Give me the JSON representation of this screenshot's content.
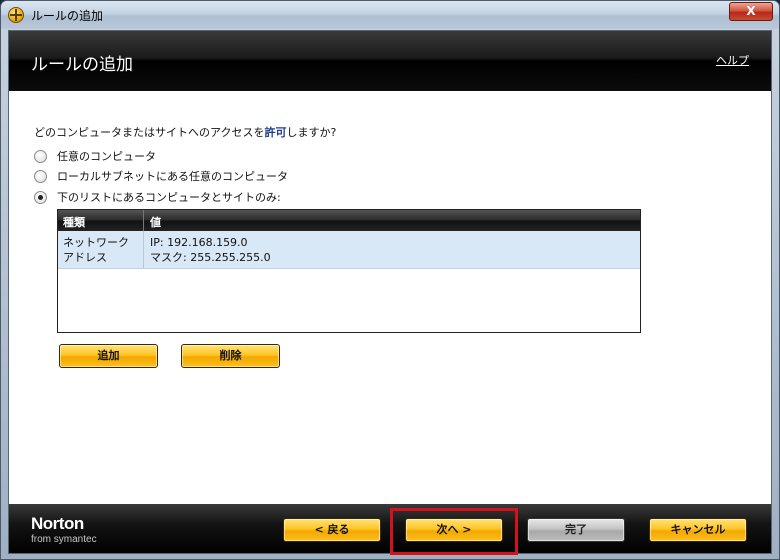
{
  "window": {
    "title": "ルールの追加",
    "close_glyph": "X"
  },
  "header": {
    "title": "ルールの追加",
    "help_label": "ヘルプ"
  },
  "question": {
    "before": "どのコンピュータまたはサイトへのアクセスを",
    "highlight": "許可",
    "after": "しますか?"
  },
  "options": [
    {
      "label": "任意のコンピュータ",
      "selected": false
    },
    {
      "label": "ローカルサブネットにある任意のコンピュータ",
      "selected": false
    },
    {
      "label": "下のリストにあるコンピュータとサイトのみ:",
      "selected": true
    }
  ],
  "list": {
    "columns": [
      "種類",
      "値"
    ],
    "rows": [
      {
        "type": "ネットワークアドレス",
        "value_line1": "IP: 192.168.159.0",
        "value_line2": "マスク: 255.255.255.0"
      }
    ]
  },
  "actions": {
    "add_label": "追加",
    "delete_label": "削除"
  },
  "footer": {
    "brand": "Norton",
    "brand_sub": "from symantec",
    "back_label": "< 戻る",
    "next_label": "次へ >",
    "finish_label": "完了",
    "cancel_label": "キャンセル"
  },
  "colors": {
    "accent_button": "#ffc526",
    "highlight_border": "#d4121c",
    "link_highlight": "#1a3e8f"
  }
}
